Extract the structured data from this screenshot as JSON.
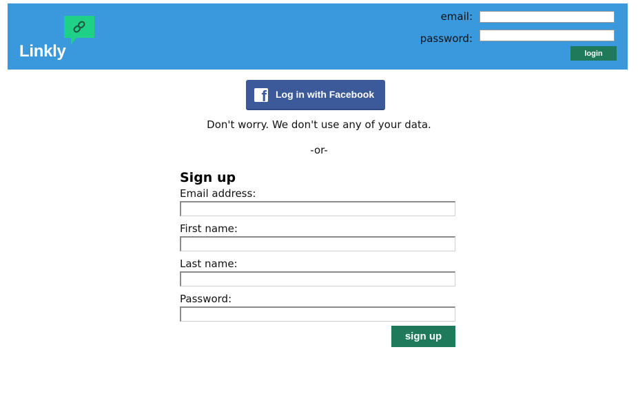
{
  "header": {
    "logo_text": "Linkly",
    "email_label": "email:",
    "password_label": "password:",
    "email_value": "",
    "password_value": "",
    "login_label": "login"
  },
  "facebook": {
    "button_label": "Log in with Facebook",
    "icon": "facebook-icon"
  },
  "note": "Don't worry. We don't use any of your data.",
  "divider": "-or-",
  "signup": {
    "title": "Sign up",
    "fields": [
      {
        "label": "Email address:",
        "value": ""
      },
      {
        "label": "First name:",
        "value": ""
      },
      {
        "label": "Last name:",
        "value": ""
      },
      {
        "label": "Password:",
        "value": ""
      }
    ],
    "submit_label": "sign up"
  },
  "colors": {
    "header_bg": "#3a98dc",
    "button_green": "#1e7a5a",
    "facebook_blue": "#3c5a99",
    "logo_bubble": "#1fd186"
  }
}
